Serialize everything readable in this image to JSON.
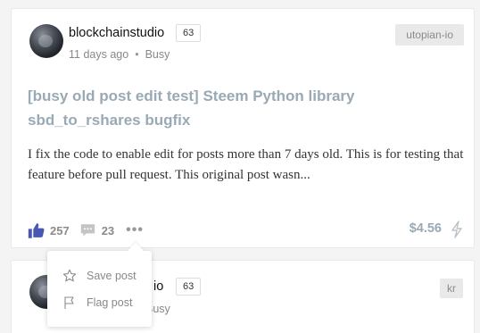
{
  "post1": {
    "author": "blockchainstudio",
    "reputation": "63",
    "time": "11 days ago",
    "app": "Busy",
    "topic": "utopian-io",
    "title": "[busy old post edit test] Steem Python library sbd_to_rshares bugfix",
    "body": "I fix the code to enable edit for posts more than 7 days old. This is for testing that feature before pull request. This original post wasn...",
    "likes": "257",
    "comments": "23",
    "payout": "$4.56",
    "like_color": "#4757b2"
  },
  "menu": {
    "save_label": "Save post",
    "flag_label": "Flag post"
  },
  "post2": {
    "author_visible": "io",
    "reputation": "63",
    "app_visible": "Busy",
    "topic": "kr"
  }
}
